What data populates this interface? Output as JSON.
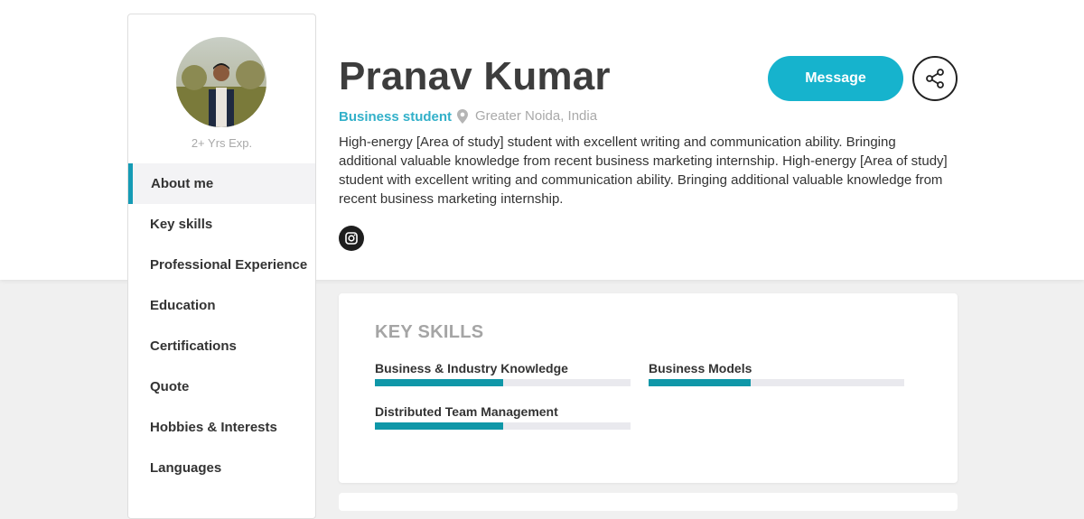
{
  "profile": {
    "experience": "2+ Yrs Exp.",
    "name": "Pranav Kumar",
    "role": "Business student",
    "location": "Greater Noida, India",
    "bio": "High-energy [Area of study] student with excellent writing and communication ability. Bringing additional valuable knowledge from recent business marketing internship. High-energy [Area of study] student with excellent writing and communication ability. Bringing additional valuable knowledge from recent business marketing internship."
  },
  "actions": {
    "message_label": "Message",
    "share_icon": "share-icon",
    "social_icon": "instagram-icon"
  },
  "nav": {
    "items": [
      {
        "label": "About me",
        "active": true
      },
      {
        "label": "Key skills"
      },
      {
        "label": "Professional Experience"
      },
      {
        "label": "Education"
      },
      {
        "label": "Certifications"
      },
      {
        "label": "Quote"
      },
      {
        "label": "Hobbies & Interests"
      },
      {
        "label": "Languages"
      }
    ]
  },
  "skills": {
    "title": "KEY SKILLS",
    "items": [
      {
        "name": "Business & Industry Knowledge",
        "level": 0.5
      },
      {
        "name": "Business Models",
        "level": 0.4
      },
      {
        "name": "Distributed Team Management",
        "level": 0.5
      }
    ]
  },
  "colors": {
    "accent": "#16b3cd",
    "role_text": "#32b0c9",
    "skill_bar": "#0f97a8"
  }
}
